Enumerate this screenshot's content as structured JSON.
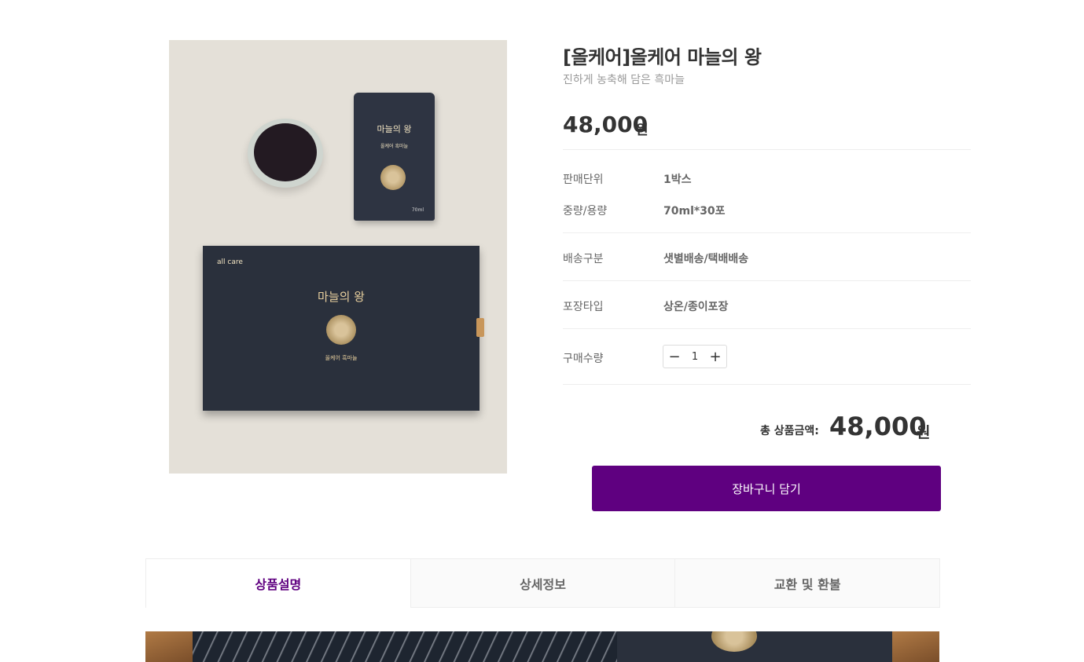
{
  "product": {
    "title": "[올케어]올케어 마늘의 왕",
    "subtitle": "진하게 농축해 담은 흑마늘",
    "price": "48,000",
    "price_unit": "원"
  },
  "image": {
    "pouch_title": "마늘의 왕",
    "pouch_sub": "올케어 흑마늘",
    "pouch_volume": "70ml",
    "box_brand": "all care",
    "box_title": "마늘의 왕",
    "box_sub": "올케어 흑마늘"
  },
  "info": {
    "rows": [
      {
        "label": "판매단위",
        "value": "1박스"
      },
      {
        "label": "중량/용량",
        "value": "70ml*30포"
      },
      {
        "label": "배송구분",
        "value": "샛별배송/택배배송"
      },
      {
        "label": "포장타입",
        "value": "상온/종이포장"
      }
    ],
    "quantity_label": "구매수량"
  },
  "quantity": {
    "minus": "−",
    "value": "1",
    "plus": "+"
  },
  "total": {
    "label": "총 상품금액:",
    "price": "48,000",
    "unit": "원"
  },
  "cart_button": "장바구니 담기",
  "tabs": [
    {
      "label": "상품설명",
      "active": true
    },
    {
      "label": "상세정보",
      "active": false
    },
    {
      "label": "교환 및 환불",
      "active": false
    }
  ],
  "colors": {
    "accent": "#5f0080",
    "text": "#333333",
    "muted": "#999999"
  }
}
